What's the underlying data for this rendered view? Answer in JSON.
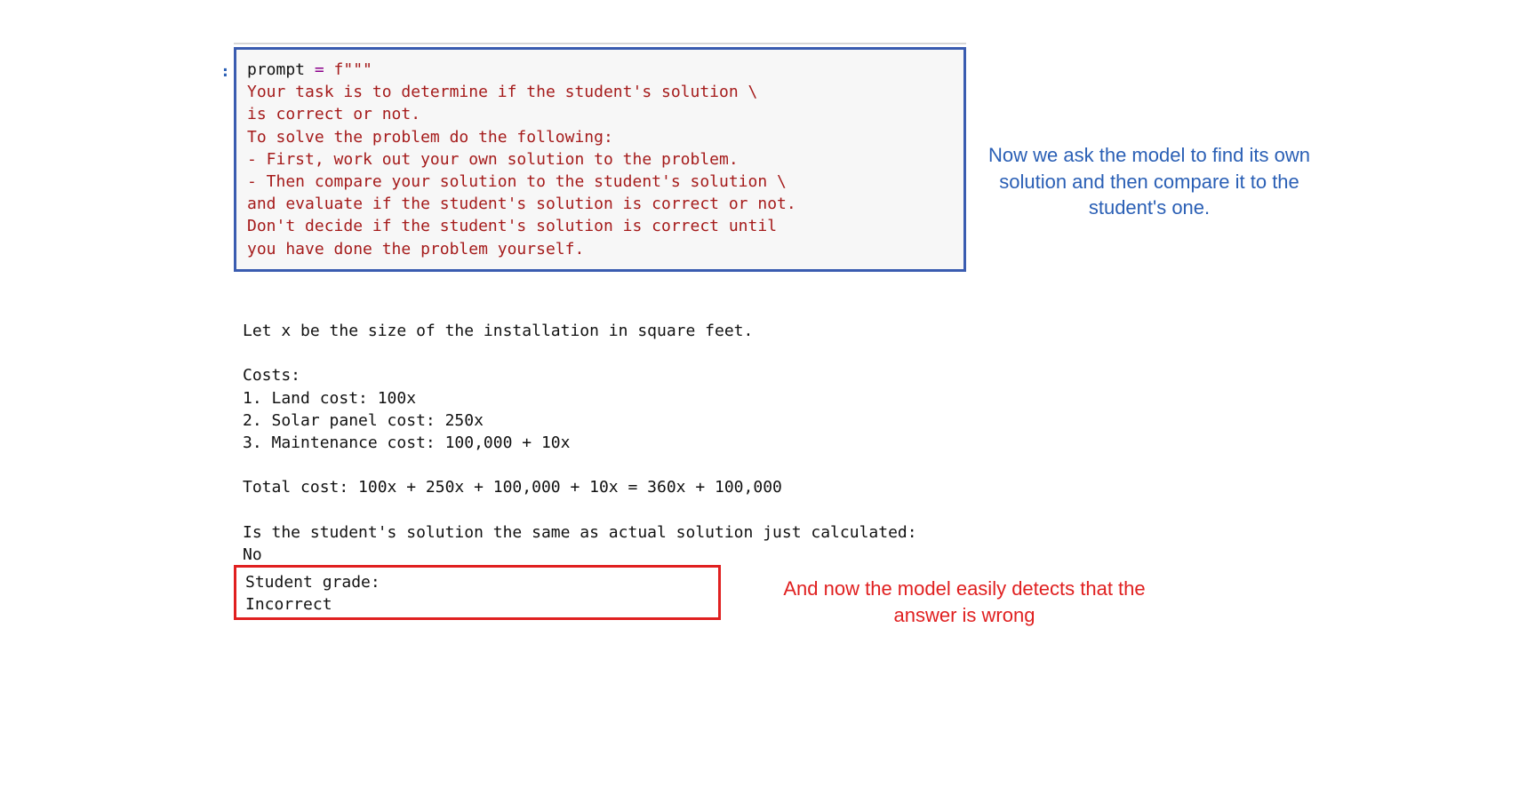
{
  "cell": {
    "marker": ":",
    "var_name": "prompt ",
    "operator": "= ",
    "fstring_prefix": "f\"\"\"",
    "prompt_line1": "Your task is to determine if the student's solution \\",
    "prompt_line2": "is correct or not.",
    "prompt_line3": "To solve the problem do the following:",
    "prompt_line4": "- First, work out your own solution to the problem.",
    "prompt_line5": "- Then compare your solution to the student's solution \\",
    "prompt_line6": "and evaluate if the student's solution is correct or not.",
    "prompt_line7": "Don't decide if the student's solution is correct until",
    "prompt_line8": "you have done the problem yourself."
  },
  "output": {
    "line1": "Let x be the size of the installation in square feet.",
    "line2": "",
    "line3": "Costs:",
    "line4": "1. Land cost: 100x",
    "line5": "2. Solar panel cost: 250x",
    "line6": "3. Maintenance cost: 100,000 + 10x",
    "line7": "",
    "line8": "Total cost: 100x + 250x + 100,000 + 10x = 360x + 100,000",
    "line9": "",
    "line10": "Is the student's solution the same as actual solution just calculated:",
    "line11": "No"
  },
  "grade": {
    "label": "Student grade:",
    "value": "Incorrect"
  },
  "annotations": {
    "top": "Now we ask the model to find its own solution and then compare it to the student's one.",
    "bottom": "And now the model easily detects that the answer is wrong"
  }
}
